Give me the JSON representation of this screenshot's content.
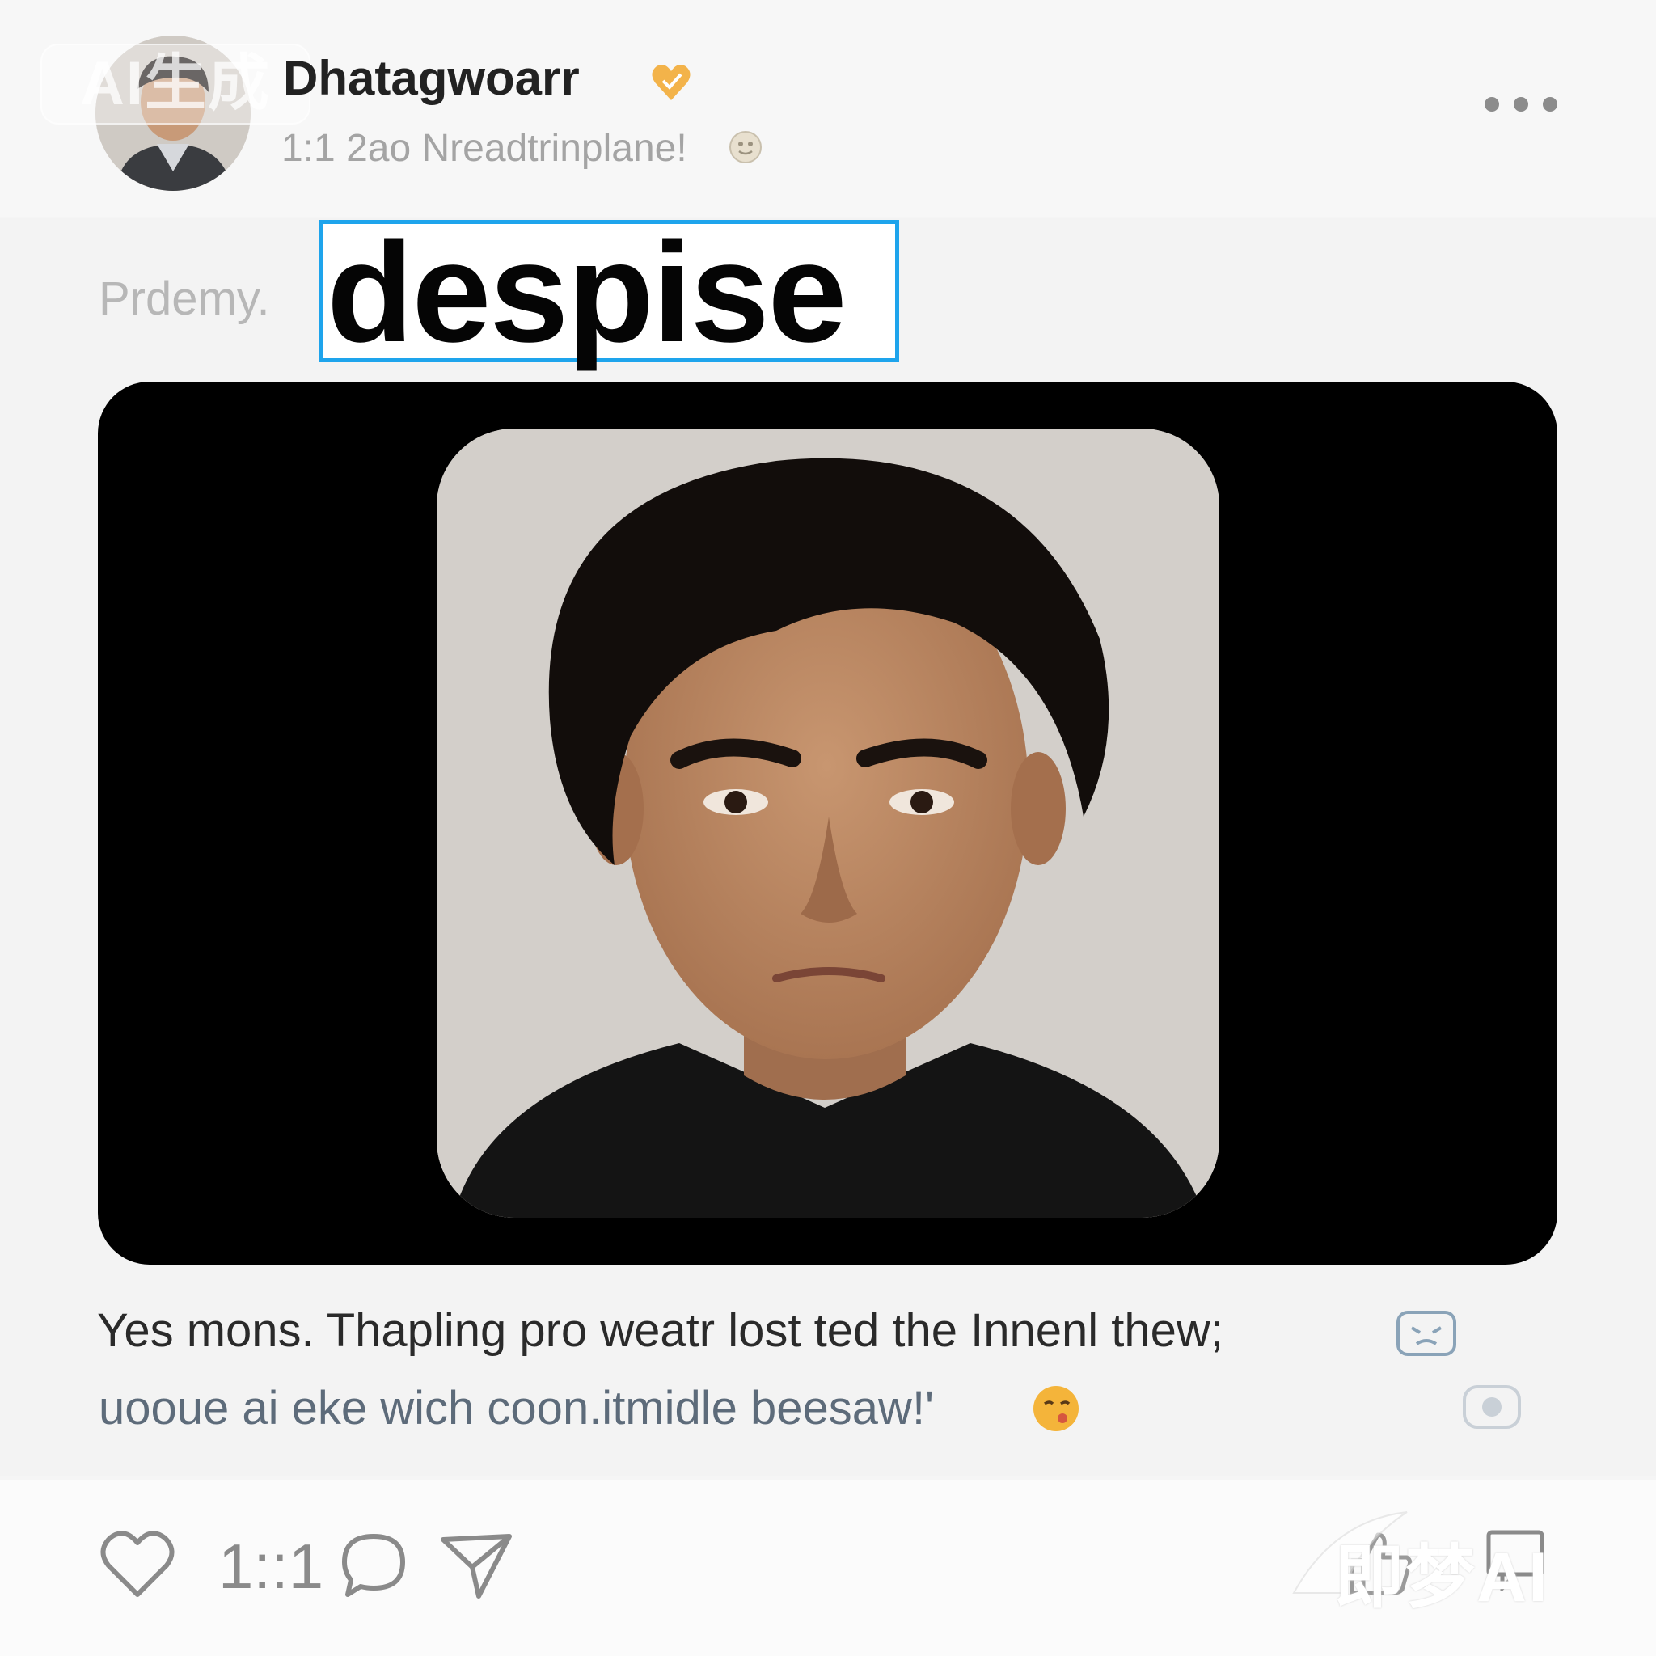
{
  "post": {
    "author": "Dhatagwoarr",
    "meta": "1:1 2ao Nreadtrinplane!",
    "prefix": "Prdemy.",
    "keyword": "despise",
    "caption_line1": "Yes mons. Thapling pro weatr lost ted the Innenl thew;",
    "caption_line2": "uooue ai eke wich coon.itmidle beesaw!'",
    "like_count": "1::1"
  },
  "watermarks": {
    "top_left": "AI生成",
    "bottom_right": "即梦AI"
  },
  "icons": {
    "verified": "heart-badge-icon",
    "more": "more-dots-icon",
    "like": "heart-icon",
    "comment": "comment-icon",
    "share": "send-icon",
    "thumbs": "thumbs-up-icon",
    "bookmark": "message-icon"
  },
  "colors": {
    "keyword_border": "#1ea4ec",
    "verified_badge": "#f3b34a"
  }
}
